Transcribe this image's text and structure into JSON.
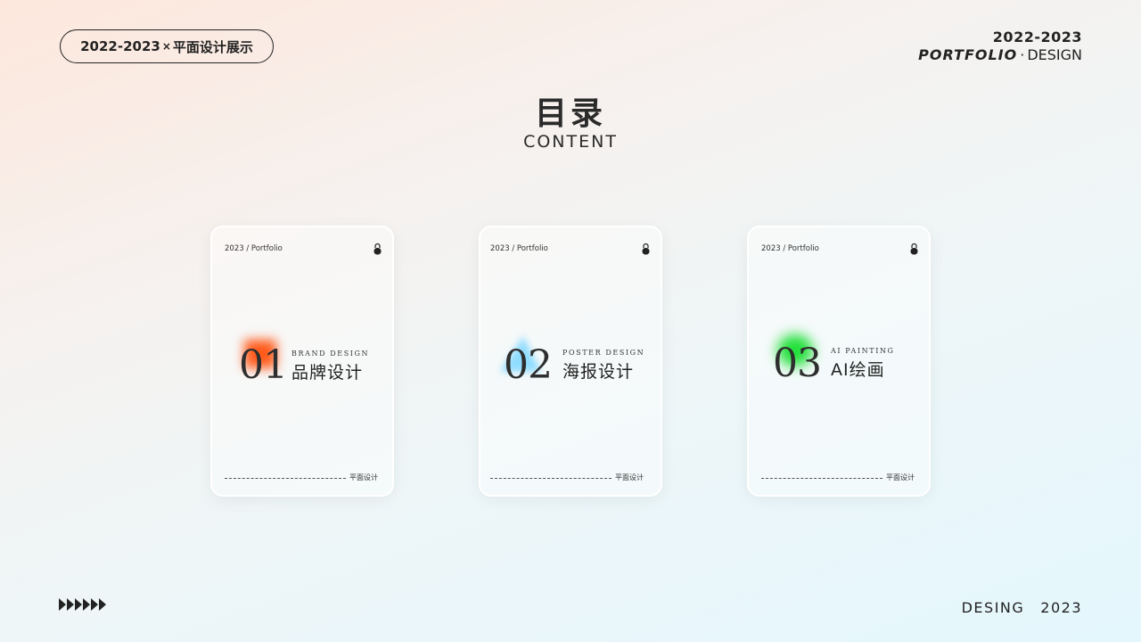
{
  "header": {
    "pill_left": "2022-2023",
    "pill_x": "×",
    "pill_right": "平面设计展示",
    "year": "2022-2023",
    "portfolio": "PORTFOLIO",
    "dot": "·",
    "design": "DESIGN"
  },
  "main": {
    "title": "目录",
    "subtitle": "CONTENT"
  },
  "cards": [
    {
      "meta": "2023 / Portfolio",
      "num": "01",
      "en": "BRAND   DESIGN",
      "cn": "品牌设计",
      "foot": "平面设计",
      "accent": "#ff5a1a"
    },
    {
      "meta": "2023 / Portfolio",
      "num": "02",
      "en": "POSTER  DESIGN",
      "cn": "海报设计",
      "foot": "平面设计",
      "accent": "#8fdcff"
    },
    {
      "meta": "2023 / Portfolio",
      "num": "03",
      "en": "AI PAINTING",
      "cn": "AI绘画",
      "foot": "平面设计",
      "accent": "#22e03a"
    }
  ],
  "footer": {
    "left_icon": "arrow-row-icon",
    "word": "DESING",
    "year": "2023"
  }
}
